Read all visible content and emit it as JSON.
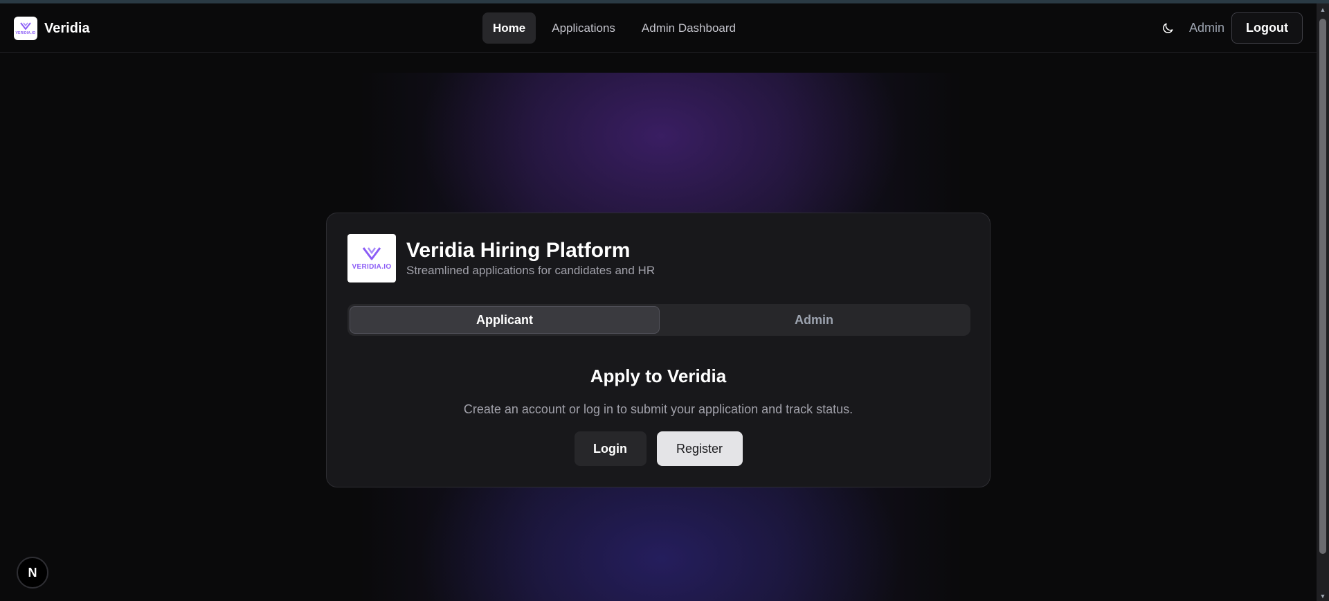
{
  "header": {
    "brand_name": "Veridia",
    "brand_logo_text": "VERIDIA.IO",
    "nav": [
      {
        "label": "Home",
        "active": true
      },
      {
        "label": "Applications",
        "active": false
      },
      {
        "label": "Admin Dashboard",
        "active": false
      }
    ],
    "theme_icon": "moon-icon",
    "user_label": "Admin",
    "logout_label": "Logout"
  },
  "card": {
    "logo_text": "VERIDIA.IO",
    "title": "Veridia Hiring Platform",
    "subtitle": "Streamlined applications for candidates and HR",
    "tabs": [
      {
        "label": "Applicant",
        "active": true
      },
      {
        "label": "Admin",
        "active": false
      }
    ],
    "apply_title": "Apply to Veridia",
    "apply_description": "Create an account or log in to submit your application and track status.",
    "login_label": "Login",
    "register_label": "Register"
  },
  "badge": {
    "label": "N",
    "icon": "nextjs-icon"
  },
  "colors": {
    "background": "#0a0a0b",
    "card": "#18181b",
    "accent": "#8b5cf6"
  }
}
